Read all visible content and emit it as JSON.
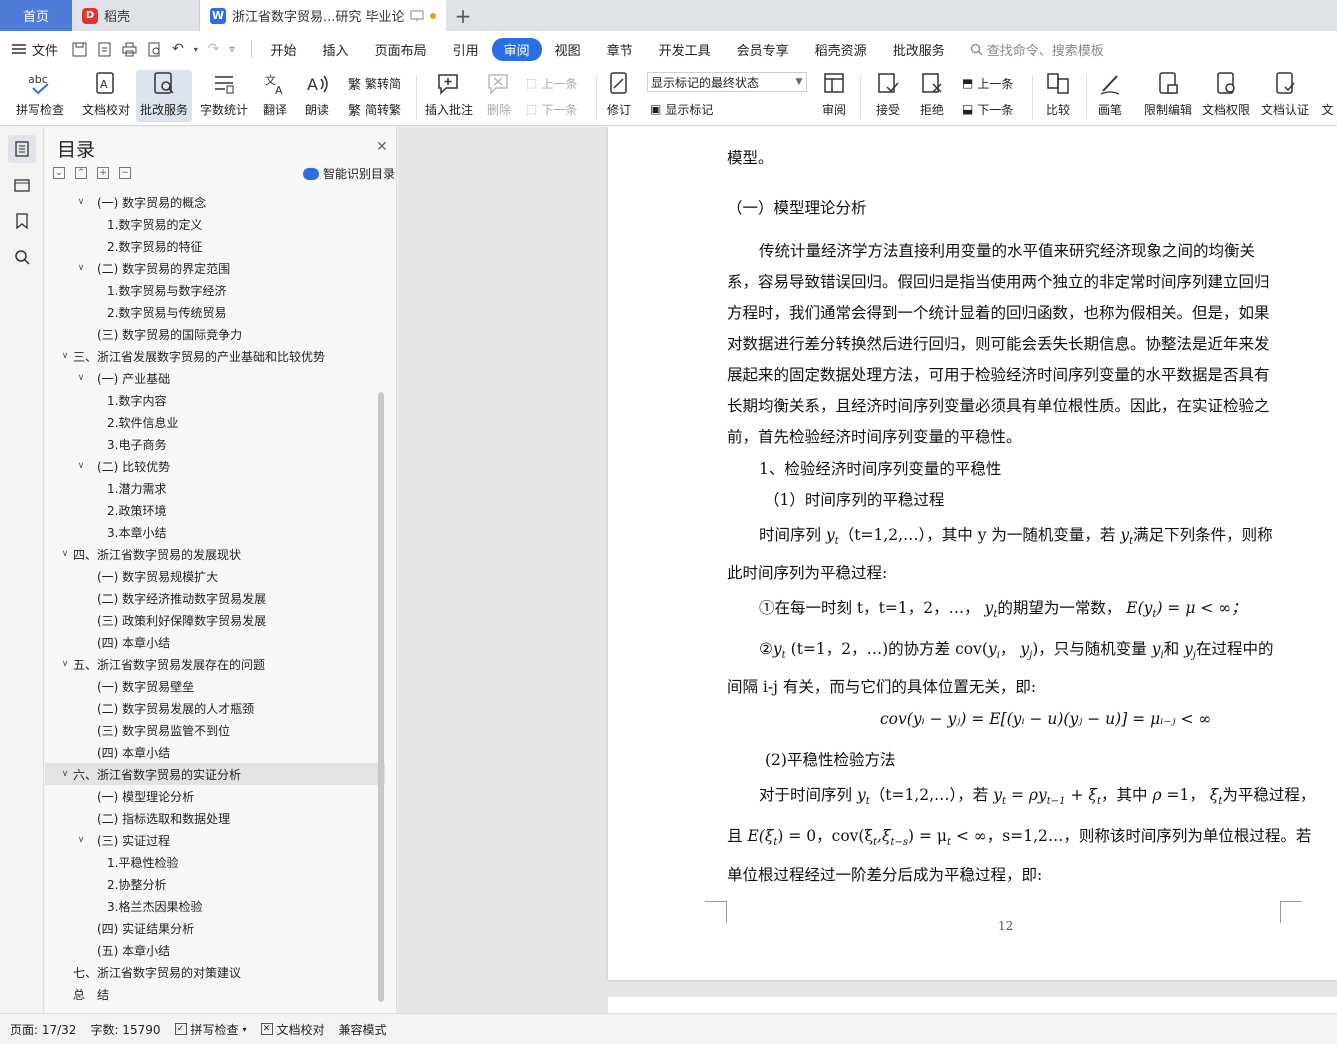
{
  "tabs": {
    "home": "首页",
    "daoke": "稻壳",
    "doc_title": "浙江省数字贸易...研究 毕业论文",
    "add": "+"
  },
  "menu": {
    "file": "文件",
    "items": [
      "开始",
      "插入",
      "页面布局",
      "引用",
      "审阅",
      "视图",
      "章节",
      "开发工具",
      "会员专享",
      "稻壳资源",
      "批改服务"
    ],
    "active": "审阅",
    "search": "查找命令、搜索模板"
  },
  "ribbon": {
    "spell": "拼写检查",
    "proof": "文档校对",
    "correct": "批改服务",
    "wordcount": "字数统计",
    "translate": "翻译",
    "read": "朗读",
    "trad": "繁转简",
    "simp": "简转繁",
    "insert_comment": "插入批注",
    "delete": "删除",
    "prev_comment": "上一条",
    "next_comment": "下一条",
    "revise": "修订",
    "markup_state": "显示标记的最终状态",
    "show_markup": "显示标记",
    "review": "审阅",
    "accept": "接受",
    "reject": "拒绝",
    "prev": "上一条",
    "next": "下一条",
    "compare": "比较",
    "pen": "画笔",
    "restrict": "限制编辑",
    "permission": "文档权限",
    "cert": "文档认证",
    "more": "文"
  },
  "sidebar_icons": [
    "toc-icon",
    "bookmark-folder-icon",
    "bookmark-icon",
    "search-icon"
  ],
  "toc": {
    "title": "目录",
    "smart": "智能识别目录",
    "items": [
      {
        "text": "(一) 数字贸易的概念",
        "level": 2,
        "arrow": true
      },
      {
        "text": "1.数字贸易的定义",
        "level": 3,
        "arrow": false
      },
      {
        "text": "2.数字贸易的特征",
        "level": 3,
        "arrow": false
      },
      {
        "text": "(二) 数字贸易的界定范围",
        "level": 2,
        "arrow": true
      },
      {
        "text": "1.数字贸易与数字经济",
        "level": 3,
        "arrow": false
      },
      {
        "text": "2.数字贸易与传统贸易",
        "level": 3,
        "arrow": false
      },
      {
        "text": "(三) 数字贸易的国际竞争力",
        "level": 2,
        "arrow": false
      },
      {
        "text": "三、浙江省发展数字贸易的产业基础和比较优势",
        "level": 1,
        "arrow": true
      },
      {
        "text": "(一) 产业基础",
        "level": 2,
        "arrow": true
      },
      {
        "text": "1.数字内容",
        "level": 3,
        "arrow": false
      },
      {
        "text": "2.软件信息业",
        "level": 3,
        "arrow": false
      },
      {
        "text": "3.电子商务",
        "level": 3,
        "arrow": false
      },
      {
        "text": "(二) 比较优势",
        "level": 2,
        "arrow": true
      },
      {
        "text": "1.潜力需求",
        "level": 3,
        "arrow": false
      },
      {
        "text": "2.政策环境",
        "level": 3,
        "arrow": false
      },
      {
        "text": "3.本章小结",
        "level": 3,
        "arrow": false
      },
      {
        "text": "四、浙江省数字贸易的发展现状",
        "level": 1,
        "arrow": true
      },
      {
        "text": "(一) 数字贸易规模扩大",
        "level": 2,
        "arrow": false
      },
      {
        "text": "(二) 数字经济推动数字贸易发展",
        "level": 2,
        "arrow": false
      },
      {
        "text": "(三) 政策利好保障数字贸易发展",
        "level": 2,
        "arrow": false
      },
      {
        "text": "(四) 本章小结",
        "level": 2,
        "arrow": false
      },
      {
        "text": "五、浙江省数字贸易发展存在的问题",
        "level": 1,
        "arrow": true
      },
      {
        "text": "(一) 数字贸易壁垒",
        "level": 2,
        "arrow": false
      },
      {
        "text": "(二) 数字贸易发展的人才瓶颈",
        "level": 2,
        "arrow": false
      },
      {
        "text": "(三) 数字贸易监管不到位",
        "level": 2,
        "arrow": false
      },
      {
        "text": "(四) 本章小结",
        "level": 2,
        "arrow": false
      },
      {
        "text": "六、浙江省数字贸易的实证分析",
        "level": 1,
        "arrow": true,
        "highlight": true
      },
      {
        "text": "(一) 模型理论分析",
        "level": 2,
        "arrow": false
      },
      {
        "text": "(二) 指标选取和数据处理",
        "level": 2,
        "arrow": false
      },
      {
        "text": "(三) 实证过程",
        "level": 2,
        "arrow": true
      },
      {
        "text": "1.平稳性检验",
        "level": 3,
        "arrow": false
      },
      {
        "text": "2.协整分析",
        "level": 3,
        "arrow": false
      },
      {
        "text": "3.格兰杰因果检验",
        "level": 3,
        "arrow": false
      },
      {
        "text": "(四) 实证结果分析",
        "level": 2,
        "arrow": false
      },
      {
        "text": "(五) 本章小结",
        "level": 2,
        "arrow": false
      },
      {
        "text": "七、浙江省数字贸易的对策建议",
        "level": 1,
        "arrow": false
      },
      {
        "text": "总　结",
        "level": 1,
        "arrow": false
      }
    ]
  },
  "document": {
    "page_number": "12",
    "lines": {
      "l0": "模型。",
      "h1": "（一）模型理论分析",
      "p1": "传统计量经济学方法直接利用变量的水平值来研究经济现象之间的均衡关",
      "p2": "系，容易导致错误回归。假回归是指当使用两个独立的非定常时间序列建立回归",
      "p3": "方程时，我们通常会得到一个统计显着的回归函数，也称为假相关。但是，如果",
      "p4": "对数据进行差分转换然后进行回归，则可能会丢失长期信息。协整法是近年来发",
      "p5": "展起来的固定数据处理方法，可用于检验经济时间序列变量的水平数据是否具有",
      "p6": "长期均衡关系，且经济时间序列变量必须具有单位根性质。因此，在实证检验之",
      "p7": "前，首先检验经济时间序列变量的平稳性。",
      "h2": "1、检验经济时间序列变量的平稳性",
      "h3": "（1）时间序列的平稳过程",
      "q1a": "时间序列",
      "q1b": "（t=1,2,…），其中 y 为一随机变量，若",
      "q1c": "满足下列条件，则称",
      "q2": "此时间序列为平稳过程:",
      "c1a": "①在每一时刻 t，t=1，2，…，",
      "c1b": "的期望为一常数，",
      "c1f": "E(y",
      "c1g": ") = μ < ∞；",
      "c2a": "②",
      "c2b": "(t=1，2，…)的协方差 cov(",
      "c2c": "，",
      "c2d": ")，只与随机变量",
      "c2e": "和",
      "c2f": "在过程中的",
      "c3": "间隔 i-j 有关，而与它们的具体位置无关，即:",
      "formula": "cov(yᵢ − yⱼ) = E[(yᵢ − u)(yⱼ − u)] = μᵢ₋ⱼ < ∞",
      "h4": "(2)平稳性检验方法",
      "d1a": "对于时间序列",
      "d1b": "（t=1,2,…），若",
      "d1c": "= ρ",
      "d1d": "+",
      "d1e": "，其中",
      "d1f": "ρ",
      "d1g": "=1，",
      "d1h": "为平稳过程，",
      "d2a": "且",
      "d2b": "E(ξ",
      "d2c": ") = 0，cov(ξ",
      "d2d": ",ξ",
      "d2e": ") = μ",
      "d2f": "< ∞，s=1,2…，则称该时间序列为单位根过程。若",
      "d3": "单位根过程经过一阶差分后成为平稳过程，即:"
    }
  },
  "status": {
    "page": "页面: 17/32",
    "words": "字数: 15790",
    "spell": "拼写检查",
    "proof": "文档校对",
    "compat": "兼容模式"
  }
}
